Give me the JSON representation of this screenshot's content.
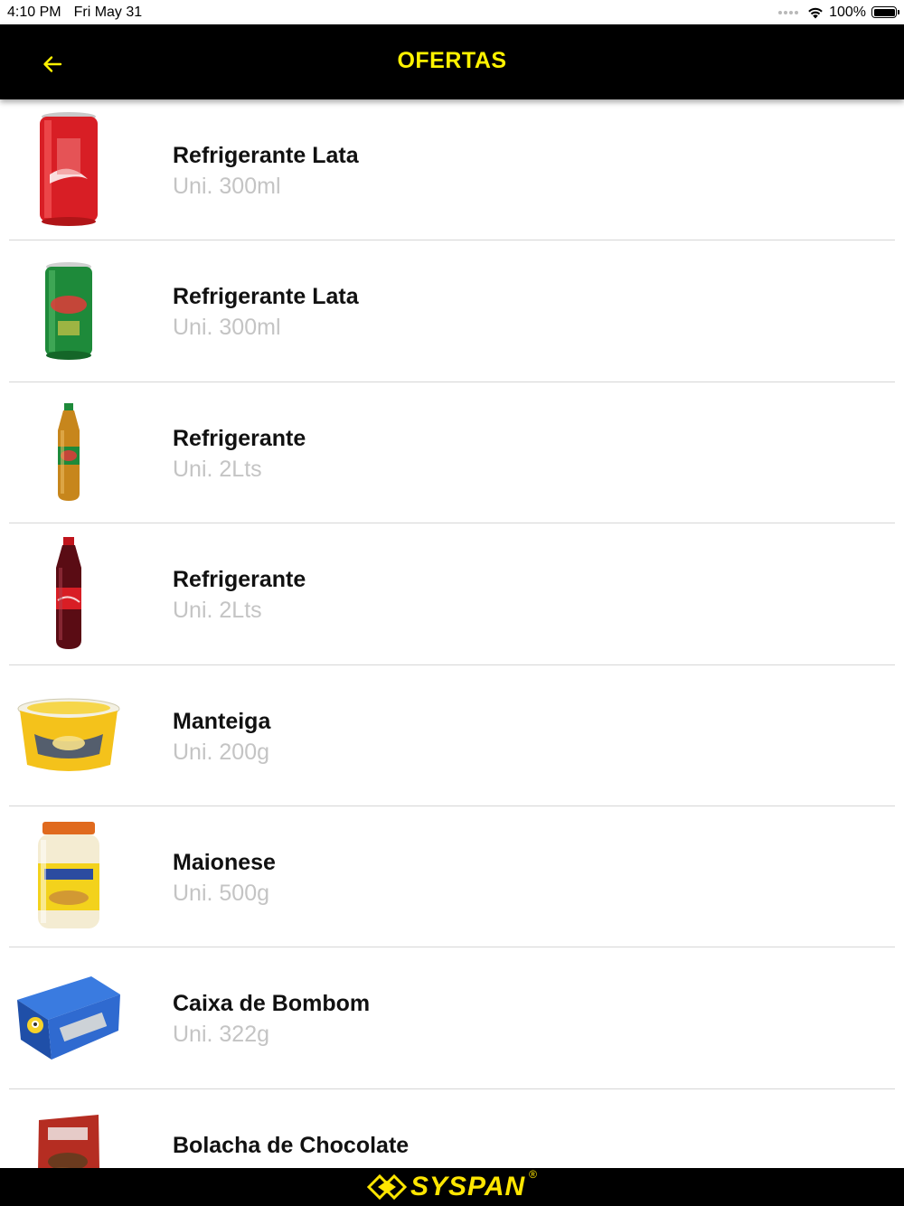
{
  "status_bar": {
    "time": "4:10 PM",
    "date": "Fri May 31",
    "battery": "100%"
  },
  "header": {
    "title": "OFERTAS",
    "back_icon": "arrow-left-icon",
    "title_color": "#FFF200",
    "background": "#000000"
  },
  "products": [
    {
      "name": "Refrigerante Lata",
      "description": "Uni. 300ml",
      "image": "red-soda-can"
    },
    {
      "name": "Refrigerante Lata",
      "description": "Uni. 300ml",
      "image": "green-soda-can"
    },
    {
      "name": "Refrigerante",
      "description": "Uni. 2Lts",
      "image": "green-soda-bottle"
    },
    {
      "name": "Refrigerante",
      "description": "Uni. 2Lts",
      "image": "red-soda-bottle"
    },
    {
      "name": "Manteiga",
      "description": "Uni. 200g",
      "image": "butter-tub"
    },
    {
      "name": "Maionese",
      "description": "Uni. 500g",
      "image": "mayonnaise-jar"
    },
    {
      "name": "Caixa de Bombom",
      "description": "Uni. 322g",
      "image": "chocolate-box"
    },
    {
      "name": "Bolacha de Chocolate",
      "description": "",
      "image": "cookie-pack"
    }
  ],
  "footer": {
    "logo_text": "SYSPAN",
    "logo_mark": "®",
    "logo_color": "#FFE600"
  }
}
